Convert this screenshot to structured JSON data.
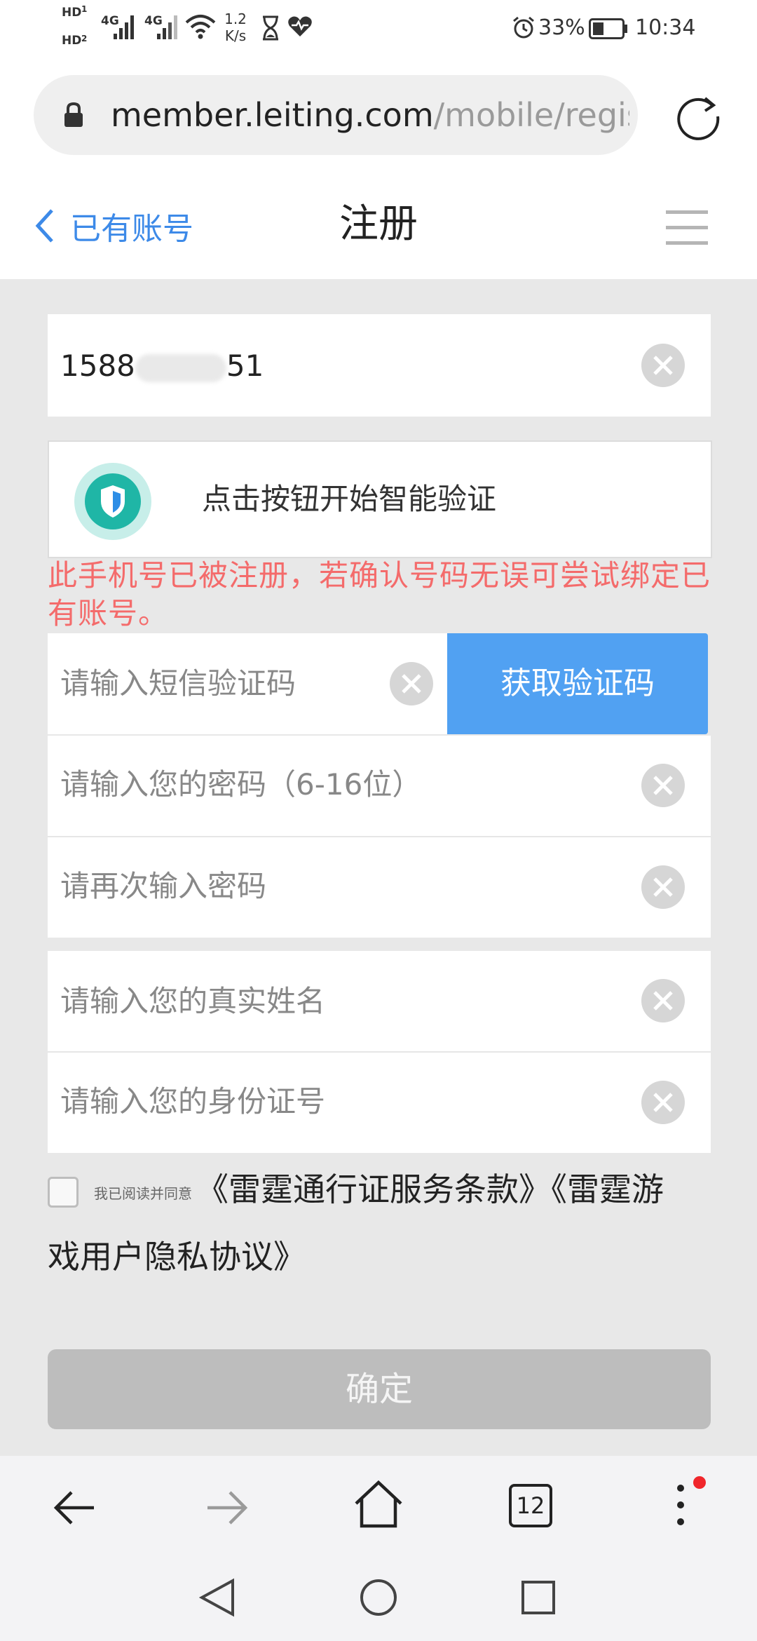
{
  "status_bar": {
    "hd1": "HD",
    "hd2": "HD",
    "sim1": "4G",
    "sim2": "4G",
    "net_speed_value": "1.2",
    "net_speed_unit": "K/s",
    "battery_percent": "33%",
    "time": "10:34"
  },
  "browser": {
    "url_domain": "member.leiting.com",
    "url_path": "/mobile/regist",
    "tab_count": "12"
  },
  "header": {
    "back_label": "已有账号",
    "title": "注册"
  },
  "form": {
    "phone_value": "1588",
    "phone_value_tail": "51",
    "verify_prompt": "点击按钮开始智能验证",
    "error_message": "此手机号已被注册，若确认号码无误可尝试绑定已有账号。",
    "sms_placeholder": "请输入短信验证码",
    "get_code_label": "获取验证码",
    "password_placeholder": "请输入您的密码（6-16位）",
    "password_confirm_placeholder": "请再次输入密码",
    "realname_placeholder": "请输入您的真实姓名",
    "idcard_placeholder": "请输入您的身份证号"
  },
  "agreement": {
    "prefix": "我已阅读并同意",
    "line1": "《雷霆通行证服务条款》《雷霆游",
    "line2": "戏用户隐私协议》"
  },
  "confirm_label": "确定",
  "colors": {
    "link_blue": "#3d8ae8",
    "button_blue": "#51a1f2",
    "error_red": "#f46b6b",
    "disabled_grey": "#bdbdbd"
  }
}
